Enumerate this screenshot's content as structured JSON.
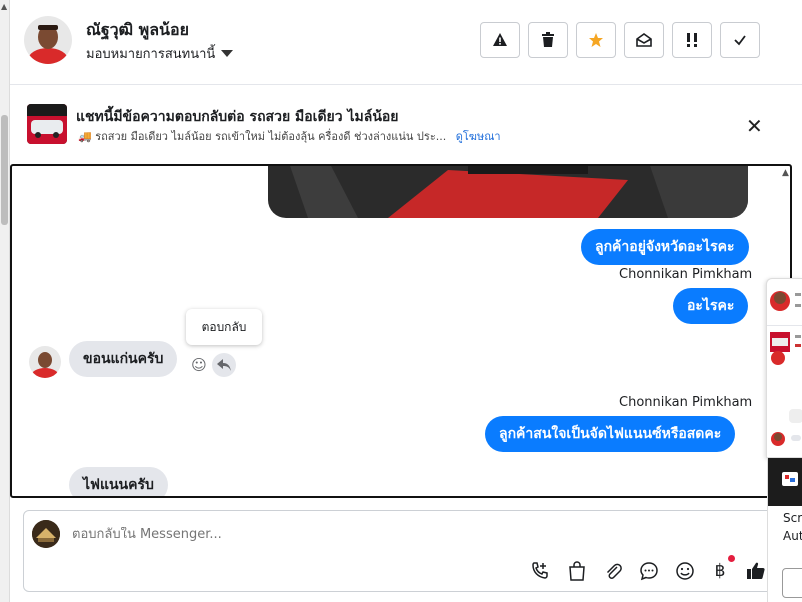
{
  "header": {
    "contact_name": "ณัฐวุฒิ พูลน้อย",
    "assign_label": "มอบหมายการสนทนานี้",
    "actions": [
      {
        "name": "report-button",
        "icon": "warning-icon"
      },
      {
        "name": "delete-button",
        "icon": "trash-icon"
      },
      {
        "name": "star-button",
        "icon": "star-icon"
      },
      {
        "name": "mark-unread-button",
        "icon": "envelope-open-icon"
      },
      {
        "name": "priority-button",
        "icon": "exclamation-icon"
      },
      {
        "name": "done-button",
        "icon": "check-icon"
      }
    ],
    "star_color": "#f5a623"
  },
  "banner": {
    "title": "แชทนี้มีข้อความตอบกลับต่อ รถสวย มือเดียว ไมล์น้อย",
    "subtitle": "🚚 รถสวย มือเดียว ไมล์น้อย รถเข้าใหม่ ไม่ต้องลุ้น ครื่องดี ช่วงล่างแน่น ประ...",
    "link": "ดูโฆษณา"
  },
  "conversation": {
    "messages": [
      {
        "direction": "out",
        "text": "ลูกค้าอยู่จังหวัดอะไรคะ"
      },
      {
        "sender": "Chonnikan Pimkham"
      },
      {
        "direction": "out",
        "text": "อะไรคะ"
      },
      {
        "direction": "in",
        "text": "ขอนแก่นครับ"
      },
      {
        "sender": "Chonnikan Pimkham"
      },
      {
        "direction": "out",
        "text": "ลูกค้าสนใจเป็นจัดไฟแนนซ์หรือสดคะ"
      },
      {
        "direction": "in",
        "text": "ไฟแนนครับ"
      }
    ],
    "tooltip": "ตอบกลับ",
    "outgoing_color": "#0a7cff",
    "incoming_color": "#e4e6eb"
  },
  "composer": {
    "placeholder": "ตอบกลับใน Messenger...",
    "icons": [
      "call-add-icon",
      "bag-icon",
      "paperclip-icon",
      "chat-bubble-icon",
      "emoji-icon",
      "baht-icon",
      "thumbs-up-icon"
    ]
  },
  "side_widget": {
    "lines": [
      "Scr",
      "Aut"
    ]
  }
}
